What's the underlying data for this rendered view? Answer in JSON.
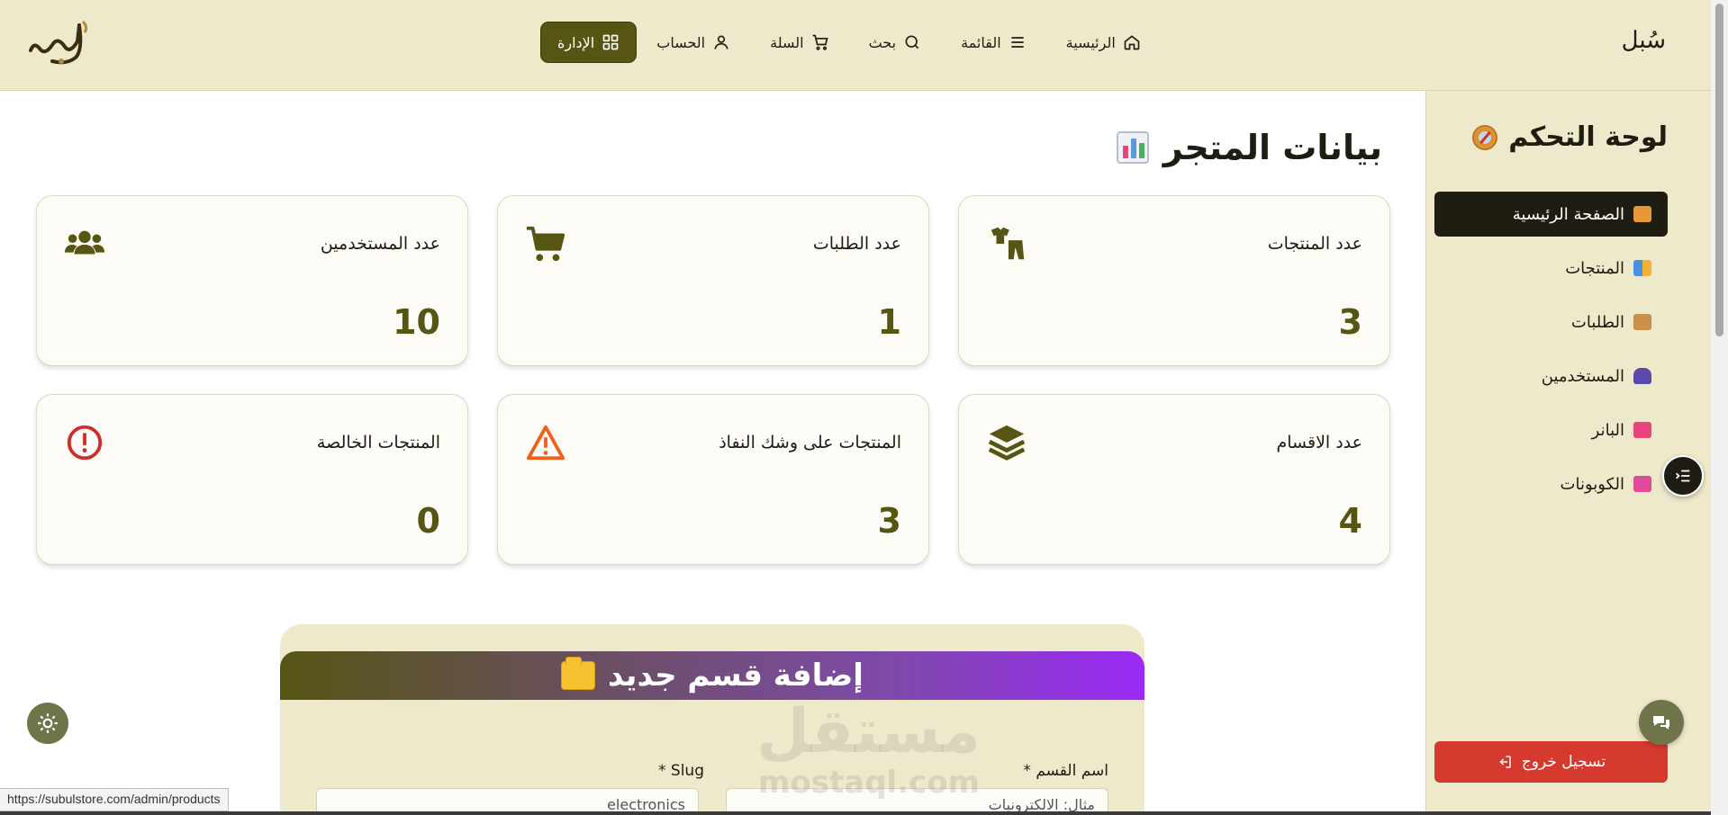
{
  "header": {
    "brand_name": "سُبل",
    "nav": [
      {
        "label": "الرئيسية",
        "icon": "home-icon"
      },
      {
        "label": "القائمة",
        "icon": "menu-icon"
      },
      {
        "label": "بحث",
        "icon": "search-icon"
      },
      {
        "label": "السلة",
        "icon": "cart-icon"
      },
      {
        "label": "الحساب",
        "icon": "user-icon"
      },
      {
        "label": "الإدارة",
        "icon": "dashboard-icon"
      }
    ]
  },
  "sidebar": {
    "title": "لوحة التحكم",
    "items": [
      {
        "label": "الصفحة الرئيسية",
        "icon": "house-emoji",
        "active": true
      },
      {
        "label": "المنتجات",
        "icon": "shopping-bags-emoji"
      },
      {
        "label": "الطلبات",
        "icon": "package-emoji"
      },
      {
        "label": "المستخدمين",
        "icon": "users-emoji"
      },
      {
        "label": "البانر",
        "icon": "megaphone-emoji"
      },
      {
        "label": "الكوبونات",
        "icon": "ticket-emoji"
      }
    ],
    "logout_label": "تسجيل خروج"
  },
  "main": {
    "title": "بيانات المتجر",
    "stats": [
      {
        "label": "عدد المنتجات",
        "value": "3",
        "icon": "clothes-icon"
      },
      {
        "label": "عدد الطلبات",
        "value": "1",
        "icon": "cart-icon"
      },
      {
        "label": "عدد المستخدمين",
        "value": "10",
        "icon": "users-icon"
      },
      {
        "label": "عدد الاقسام",
        "value": "4",
        "icon": "layers-icon"
      },
      {
        "label": "المنتجات على وشك النفاذ",
        "value": "3",
        "icon": "warning-icon"
      },
      {
        "label": "المنتجات الخالصة",
        "value": "0",
        "icon": "alert-circle-icon"
      }
    ],
    "add_category": {
      "title": "إضافة قسم جديد",
      "name_label": "اسم القسم *",
      "name_value": "مثال: الالكترونيات",
      "slug_label": "Slug *",
      "slug_value": "electronics"
    }
  },
  "watermark": {
    "arabic": "مستقل",
    "latin": "mostaql.com"
  },
  "statusbar_url": "https://subulstore.com/admin/products",
  "colors": {
    "accent": "#565514",
    "beige": "#efe9cc",
    "danger": "#d63a2f",
    "dark": "#1f1d12"
  }
}
